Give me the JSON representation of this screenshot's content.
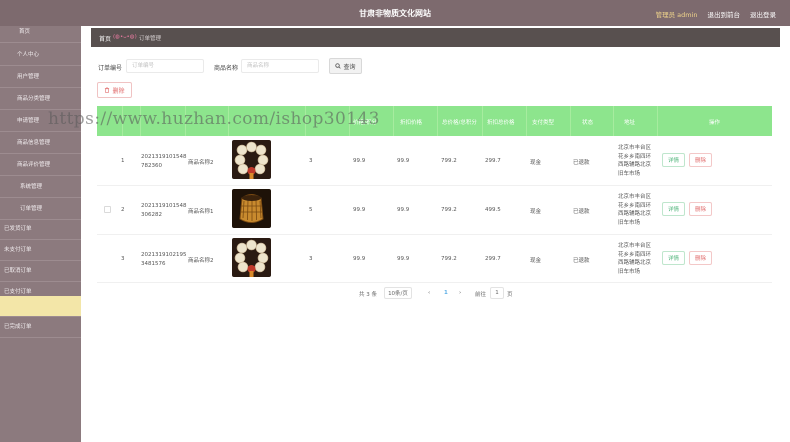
{
  "header": {
    "title": "甘肃非物质文化网站",
    "admin_label": "管理员 admin",
    "front_link": "退出到前台",
    "logout_link": "退出登录"
  },
  "sidebar": {
    "items": [
      {
        "label": "首页"
      },
      {
        "label": "个人中心"
      },
      {
        "label": "用户管理"
      },
      {
        "label": "商品分类管理"
      },
      {
        "label": "申请管理"
      },
      {
        "label": "商品信息管理"
      },
      {
        "label": "商品评价管理"
      },
      {
        "label": "系统管理"
      },
      {
        "label": "订单管理"
      },
      {
        "label": "已发货订单"
      },
      {
        "label": "未支付订单"
      },
      {
        "label": "已取消订单"
      },
      {
        "label": "已支付订单"
      },
      {
        "label": "已退款订单"
      },
      {
        "label": "已完成订单"
      }
    ]
  },
  "breadcrumb": {
    "home": "首页",
    "emoji": "(◍•ᴗ•◍)",
    "current": "订单管理"
  },
  "filters": {
    "order_no_label": "订单编号",
    "order_no_placeholder": "订单编号",
    "product_name_label": "商品名称",
    "product_name_placeholder": "商品名称",
    "search_label": "查询",
    "delete_label": "删除"
  },
  "table": {
    "headers": [
      "价格/积分",
      "折扣价格",
      "总价格/总积分",
      "折扣总价格",
      "支付类型",
      "状态",
      "地址",
      "操作"
    ],
    "rows": [
      {
        "index": "1",
        "order_no": "20213191015487 82360",
        "order_no_l1": "202131910154​8",
        "order_no_l2": "782360",
        "product": "商品名称2",
        "img": "beads",
        "qty": "3",
        "price": "99.9",
        "discount_price": "99.9",
        "total": "799.2",
        "discount_total": "299.7",
        "pay_type": "现金",
        "status": "已退款",
        "addr": [
          "北京市丰台区",
          "花乡乡南四环",
          "西路辅路北京",
          "旧车市场"
        ],
        "detail": "详情",
        "delete": "删除"
      },
      {
        "index": "2",
        "order_no_l1": "202131910154​8",
        "order_no_l2": "306282",
        "product": "商品名称1",
        "img": "basket",
        "qty": "5",
        "price": "99.9",
        "discount_price": "99.9",
        "total": "799.2",
        "discount_total": "499.5",
        "pay_type": "现金",
        "status": "已退款",
        "addr": [
          "北京市丰台区",
          "花乡乡南四环",
          "西路辅路北京",
          "旧车市场"
        ],
        "detail": "详情",
        "delete": "删除"
      },
      {
        "index": "3",
        "order_no_l1": "202131910219​5",
        "order_no_l2": "3481576",
        "product": "商品名称2",
        "img": "beads",
        "qty": "3",
        "price": "99.9",
        "discount_price": "99.9",
        "total": "799.2",
        "discount_total": "299.7",
        "pay_type": "现金",
        "status": "已退款",
        "addr": [
          "北京市丰台区",
          "花乡乡南四环",
          "西路辅路北京",
          "旧车市场"
        ],
        "detail": "详情",
        "delete": "删除"
      }
    ]
  },
  "pagination": {
    "total": "共 3 条",
    "page_size": "10条/页",
    "prev": "‹",
    "current": "1",
    "next": "›",
    "goto": "前往",
    "goto_page": "1",
    "page_unit": "页"
  },
  "watermark": "https://www.huzhan.com/ishop30143",
  "colors": {
    "topbar": "#7d6a6e",
    "sidebar": "#8c7a7e",
    "sidebar_active": "#f3e6a8",
    "table_header": "#8de58d",
    "breadcrumb_bar": "#58504f"
  }
}
